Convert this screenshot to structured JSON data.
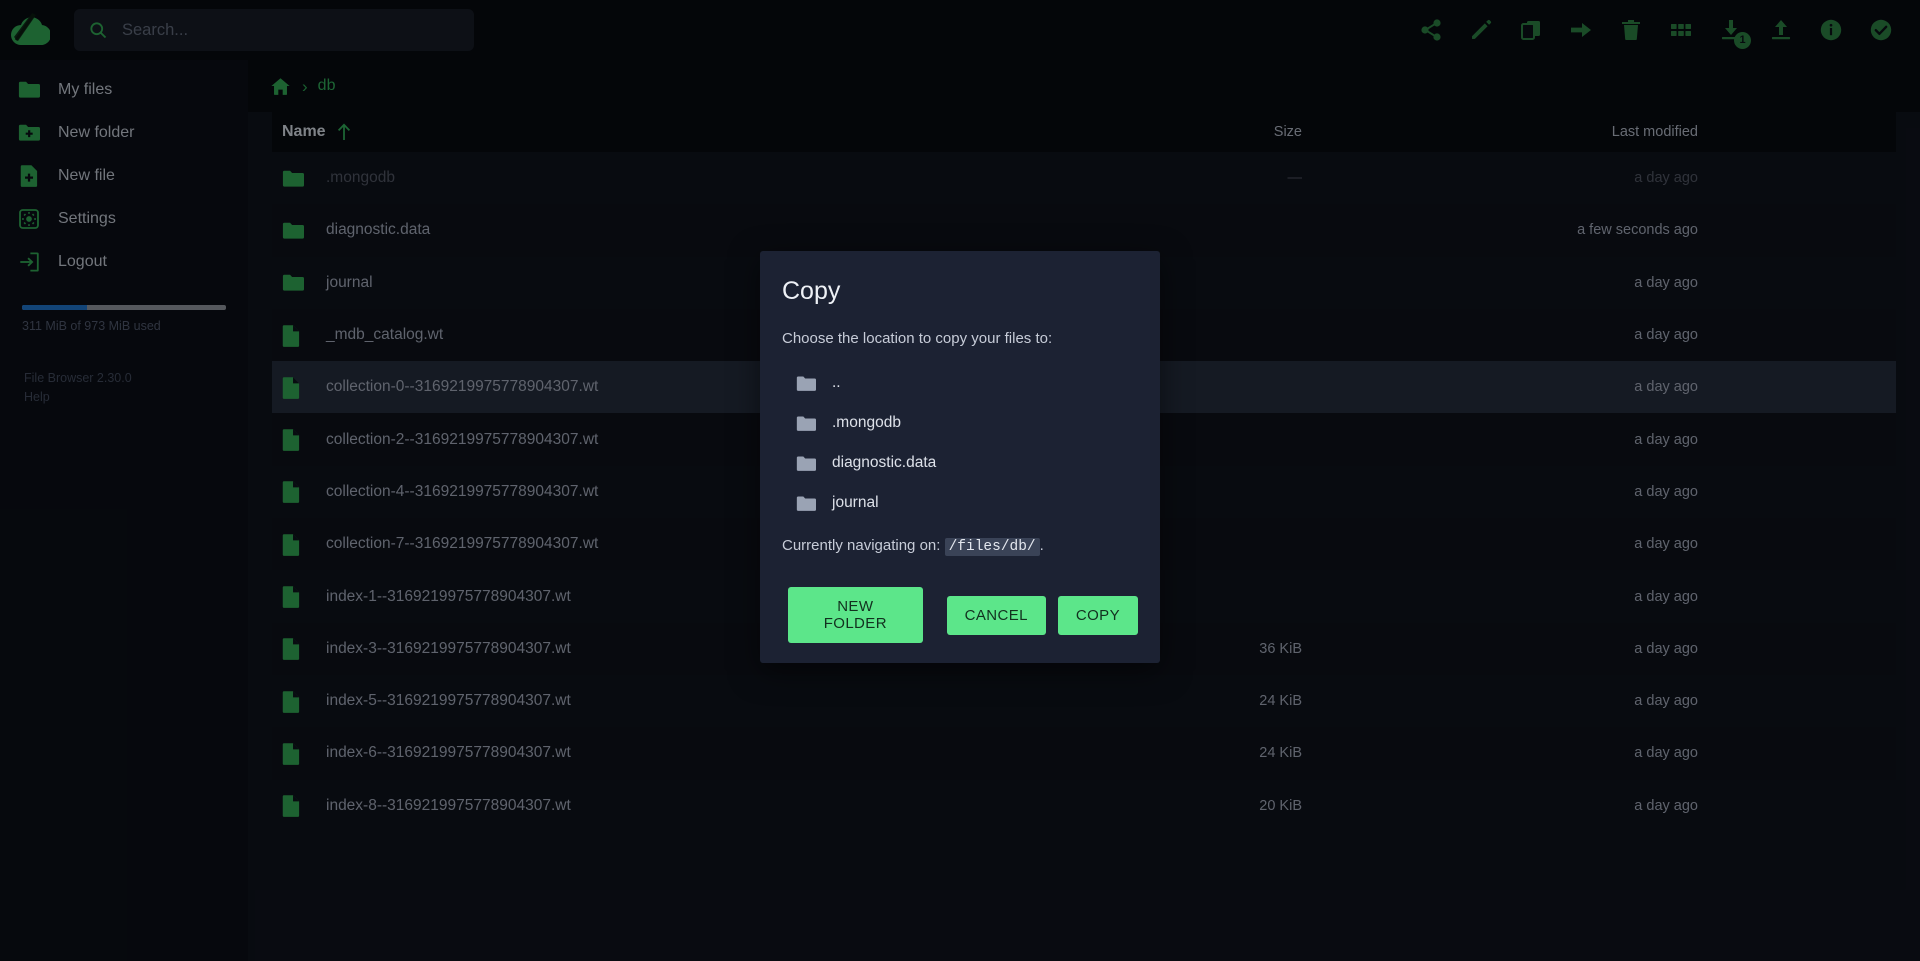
{
  "app": {
    "title": "File Browser",
    "logo_icon": "cloud-k-logo"
  },
  "search": {
    "placeholder": "Search...",
    "value": "",
    "icon": "search-icon"
  },
  "toolbar": {
    "buttons": [
      {
        "name": "share-icon",
        "label": "Share"
      },
      {
        "name": "rename-icon",
        "label": "Rename"
      },
      {
        "name": "copy-icon",
        "label": "Copy"
      },
      {
        "name": "move-icon",
        "label": "Move"
      },
      {
        "name": "delete-icon",
        "label": "Delete"
      },
      {
        "name": "switch-view-icon",
        "label": "Switch view"
      },
      {
        "name": "download-icon",
        "label": "Download",
        "badge": "1"
      },
      {
        "name": "upload-icon",
        "label": "Upload"
      },
      {
        "name": "info-icon",
        "label": "Info"
      },
      {
        "name": "select-all-icon",
        "label": "Select all"
      }
    ]
  },
  "sidebar": {
    "items": [
      {
        "icon": "folder-icon",
        "label": "My files"
      },
      {
        "icon": "folder-add-icon",
        "label": "New folder"
      },
      {
        "icon": "file-add-icon",
        "label": "New file"
      },
      {
        "icon": "gear-icon",
        "label": "Settings"
      },
      {
        "icon": "logout-icon",
        "label": "Logout"
      }
    ],
    "usage": {
      "text": "311 MiB of 973 MiB used",
      "percent": 32
    },
    "about": {
      "version": "File Browser 2.30.0",
      "help": "Help"
    }
  },
  "breadcrumb": {
    "home_icon": "home-icon",
    "separator": "›",
    "path": [
      "db"
    ]
  },
  "filelist": {
    "columns": {
      "name": "Name",
      "size": "Size",
      "modified": "Last modified"
    },
    "sort": {
      "column": "name",
      "direction": "asc",
      "icon": "arrow-up-icon"
    },
    "rows": [
      {
        "icon": "folder-icon",
        "name": ".mongodb",
        "size": "—",
        "modified": "a day ago",
        "dim": true,
        "selected": false
      },
      {
        "icon": "folder-icon",
        "name": "diagnostic.data",
        "size": "",
        "modified": "a few seconds ago",
        "dim": false,
        "selected": false
      },
      {
        "icon": "folder-icon",
        "name": "journal",
        "size": "",
        "modified": "a day ago",
        "dim": false,
        "selected": false
      },
      {
        "icon": "file-icon",
        "name": "_mdb_catalog.wt",
        "size": "",
        "modified": "a day ago",
        "dim": false,
        "selected": false
      },
      {
        "icon": "file-icon",
        "name": "collection-0--3169219975778904307.wt",
        "size": "",
        "modified": "a day ago",
        "dim": false,
        "selected": true
      },
      {
        "icon": "file-icon",
        "name": "collection-2--3169219975778904307.wt",
        "size": "",
        "modified": "a day ago",
        "dim": false,
        "selected": false
      },
      {
        "icon": "file-icon",
        "name": "collection-4--3169219975778904307.wt",
        "size": "",
        "modified": "a day ago",
        "dim": false,
        "selected": false
      },
      {
        "icon": "file-icon",
        "name": "collection-7--3169219975778904307.wt",
        "size": "",
        "modified": "a day ago",
        "dim": false,
        "selected": false
      },
      {
        "icon": "file-icon",
        "name": "index-1--3169219975778904307.wt",
        "size": "",
        "modified": "a day ago",
        "dim": false,
        "selected": false
      },
      {
        "icon": "file-icon",
        "name": "index-3--3169219975778904307.wt",
        "size": "36 KiB",
        "modified": "a day ago",
        "dim": false,
        "selected": false
      },
      {
        "icon": "file-icon",
        "name": "index-5--3169219975778904307.wt",
        "size": "24 KiB",
        "modified": "a day ago",
        "dim": false,
        "selected": false
      },
      {
        "icon": "file-icon",
        "name": "index-6--3169219975778904307.wt",
        "size": "24 KiB",
        "modified": "a day ago",
        "dim": false,
        "selected": false
      },
      {
        "icon": "file-icon",
        "name": "index-8--3169219975778904307.wt",
        "size": "20 KiB",
        "modified": "a day ago",
        "dim": false,
        "selected": false
      }
    ]
  },
  "dialog": {
    "title": "Copy",
    "subtitle": "Choose the location to copy your files to:",
    "folders": [
      {
        "icon": "folder-icon",
        "label": ".."
      },
      {
        "icon": "folder-icon",
        "label": ".mongodb"
      },
      {
        "icon": "folder-icon",
        "label": "diagnostic.data"
      },
      {
        "icon": "folder-icon",
        "label": "journal"
      }
    ],
    "path_prefix": "Currently navigating on:",
    "path": "/files/db/",
    "path_suffix": ".",
    "buttons": {
      "new_folder": "NEW FOLDER",
      "cancel": "CANCEL",
      "copy": "COPY"
    }
  },
  "colors": {
    "accent_green": "#2f9e4f",
    "button_green": "#5ce68a",
    "background": "#0e121b",
    "panel": "#070a10",
    "dialog": "#1c2233",
    "usage_bar": "#1d6ec0"
  }
}
